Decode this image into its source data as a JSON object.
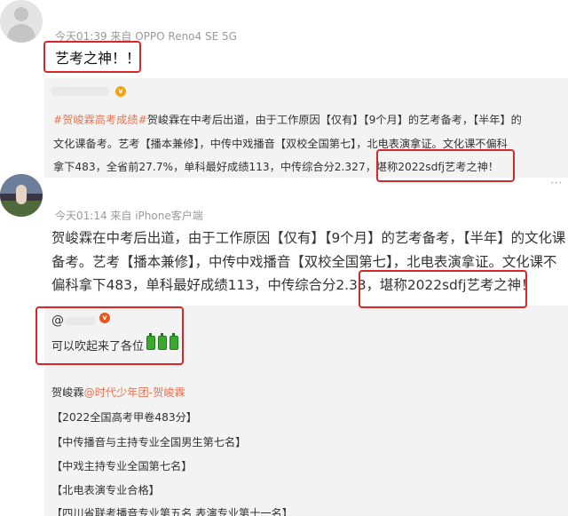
{
  "comment1": {
    "meta": "今天01:39 来自 OPPO Reno4 SE 5G",
    "text": "艺考之神！！",
    "quote": {
      "hashtag": "#贺峻霖高考成绩#",
      "line1_rest": "贺峻霖在中考后出道，由于工作原因【仅有】【9个月】的艺考备考，【半年】的",
      "line2": "文化课备考。艺考【播本兼修】，中传中戏播音【双校全国第七】，北电表演拿证。文化课不偏科",
      "line3": "拿下483，全省前27.7%，单科最好成绩113，中传综合分2.327，堪称2022sdfj艺考之神！"
    }
  },
  "comment2": {
    "meta": "今天01:14 来自 iPhone客户端",
    "line1": "贺峻霖在中考后出道，由于工作原因【仅有】【9个月】的艺考备考，【半年】的文化课",
    "line2": "备考。艺考【播本兼修】，中传中戏播音【双校全国第七】，北电表演拿证。文化课不",
    "line3": "偏科拿下483，单科最好成绩113，中传综合分2.33，堪称2022sdfj艺考之神！",
    "more_icon": "⋯"
  },
  "reply": {
    "at": "@",
    "badge": "v",
    "text": "可以吹起来了各位"
  },
  "profile": {
    "name": "贺峻霖",
    "link": "@时代少年团-贺峻霖"
  },
  "achievements": [
    "【2022全国高考甲卷483分】",
    "【中传播音与主持专业全国男生第七名】",
    "【中戏主持专业全国第七名】",
    "【北电表演专业合格】",
    "【四川省联考播音专业第五名 表演专业第十一名】"
  ],
  "colors": {
    "highlight_border": "#d9262b",
    "hashtag": "#eb7350",
    "meta_text": "#9a9a9a",
    "quote_bg": "#f3f3f3",
    "battery_green": "#3aa831"
  },
  "icons": {
    "avatar1": "default-avatar-icon",
    "avatar2": "user-photo-avatar",
    "more": "more-dots-icon",
    "verified": "verified-badge-icon",
    "battery": "battery-full-icon"
  }
}
